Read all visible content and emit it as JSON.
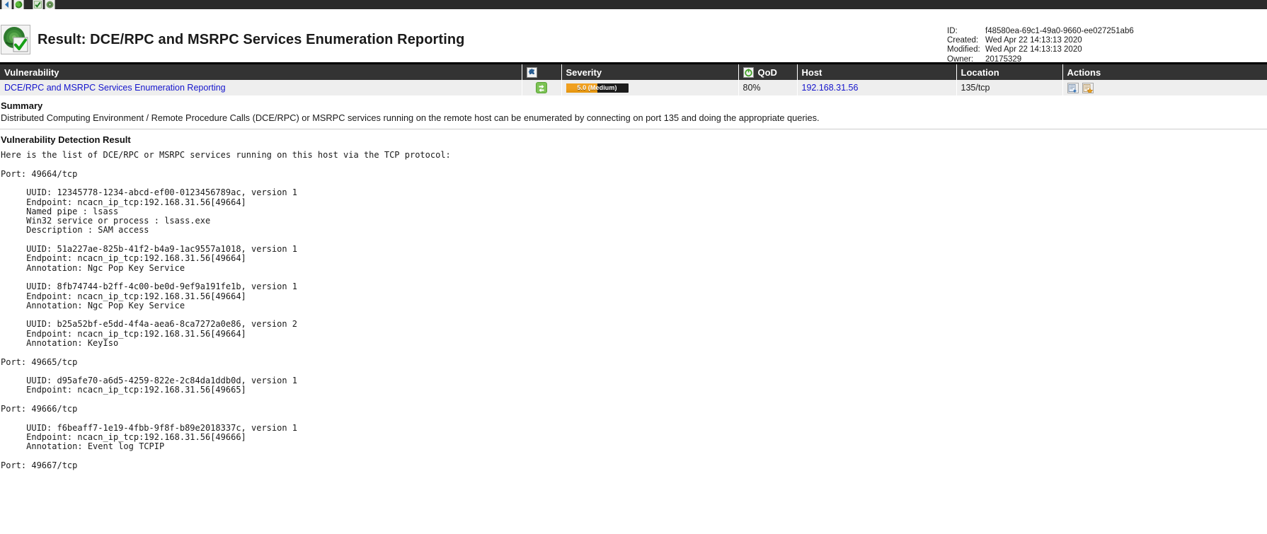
{
  "toolbar": {
    "icons": [
      {
        "name": "back-arrow-icon",
        "glyph": "back"
      },
      {
        "name": "refresh-icon",
        "glyph": "refresh"
      },
      {
        "name": "checkmark-tag-icon",
        "glyph": "check"
      },
      {
        "name": "scan-target-icon",
        "glyph": "target"
      }
    ]
  },
  "header": {
    "badge_icon": "result-check-icon",
    "title": "Result: DCE/RPC and MSRPC Services Enumeration Reporting",
    "meta": [
      {
        "key": "ID:",
        "value": "f48580ea-69c1-49a0-9660-ee027251ab6"
      },
      {
        "key": "Created:",
        "value": "Wed Apr 22 14:13:13 2020"
      },
      {
        "key": "Modified:",
        "value": "Wed Apr 22 14:13:13 2020"
      },
      {
        "key": "Owner:",
        "value": "20175329"
      }
    ]
  },
  "results_table": {
    "columns": [
      {
        "label": "Vulnerability",
        "icon": ""
      },
      {
        "label": "",
        "icon": "solution-type-puzzle-icon"
      },
      {
        "label": "Severity",
        "icon": ""
      },
      {
        "label": "",
        "icon": "qod-power-icon"
      },
      {
        "label": "QoD",
        "icon": ""
      },
      {
        "label": "Host",
        "icon": ""
      },
      {
        "label": "Location",
        "icon": ""
      },
      {
        "label": "Actions",
        "icon": ""
      }
    ],
    "row": {
      "vulnerability": "DCE/RPC and MSRPC Services Enumeration Reporting",
      "solution_icon": "solution-vendorfix-icon",
      "severity_value": "5.0 (Medium)",
      "severity_score": 5.0,
      "severity_max": 10.0,
      "severity_color": "#f0a020",
      "qod": "80%",
      "host": "192.168.31.56",
      "location": "135/tcp",
      "actions": [
        {
          "name": "add-to-assets-icon"
        },
        {
          "name": "create-override-icon"
        }
      ]
    }
  },
  "sections": {
    "summary_heading": "Summary",
    "summary_text": "Distributed Computing Environment / Remote Procedure Calls (DCE/RPC) or MSRPC services running on the remote host can be enumerated by connecting on port 135 and doing the appropriate queries.",
    "detection_heading": "Vulnerability Detection Result",
    "detection_text": "Here is the list of DCE/RPC or MSRPC services running on this host via the TCP protocol:\n\nPort: 49664/tcp\n\n     UUID: 12345778-1234-abcd-ef00-0123456789ac, version 1\n     Endpoint: ncacn_ip_tcp:192.168.31.56[49664]\n     Named pipe : lsass\n     Win32 service or process : lsass.exe\n     Description : SAM access\n\n     UUID: 51a227ae-825b-41f2-b4a9-1ac9557a1018, version 1\n     Endpoint: ncacn_ip_tcp:192.168.31.56[49664]\n     Annotation: Ngc Pop Key Service\n\n     UUID: 8fb74744-b2ff-4c00-be0d-9ef9a191fe1b, version 1\n     Endpoint: ncacn_ip_tcp:192.168.31.56[49664]\n     Annotation: Ngc Pop Key Service\n\n     UUID: b25a52bf-e5dd-4f4a-aea6-8ca7272a0e86, version 2\n     Endpoint: ncacn_ip_tcp:192.168.31.56[49664]\n     Annotation: KeyIso\n\nPort: 49665/tcp\n\n     UUID: d95afe70-a6d5-4259-822e-2c84da1ddb0d, version 1\n     Endpoint: ncacn_ip_tcp:192.168.31.56[49665]\n\nPort: 49666/tcp\n\n     UUID: f6beaff7-1e19-4fbb-9f8f-b89e2018337c, version 1\n     Endpoint: ncacn_ip_tcp:192.168.31.56[49666]\n     Annotation: Event log TCPIP\n\nPort: 49667/tcp"
  }
}
